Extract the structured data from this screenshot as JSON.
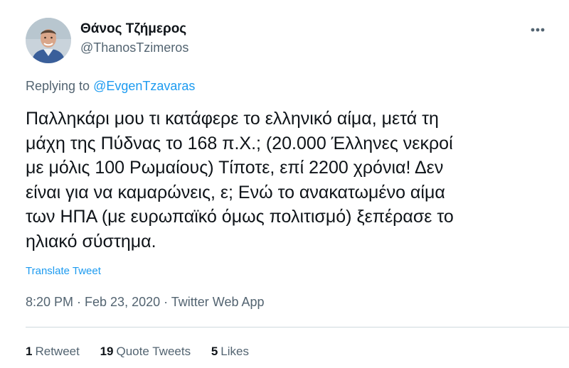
{
  "author": {
    "display_name": "Θάνος Τζήμερος",
    "handle": "@ThanosTzimeros"
  },
  "reply": {
    "prefix": "Replying to",
    "mention": "@EvgenTzavaras"
  },
  "tweet": {
    "lines": [
      "Παλληκάρι μου τι κατάφερε το ελληνικό αίμα, μετά τη",
      "μάχη της Πύδνας το 168 π.Χ.; (20.000 Έλληνες νεκροί",
      "με μόλις 100 Ρωμαίους) Τίποτε, επί 2200 χρόνια! Δεν",
      "είναι για να καμαρώνεις, ε; Ενώ το ανακατωμένο αίμα",
      "των ΗΠΑ (με ευρωπαϊκό όμως πολιτισμό) ξεπέρασε το",
      "ηλιακό σύστημα."
    ],
    "translate_label": "Translate Tweet",
    "timestamp": "8:20 PM · Feb 23, 2020 · Twitter Web App"
  },
  "stats": {
    "retweets_count": "1",
    "retweets_label": "Retweet",
    "quotes_count": "19",
    "quotes_label": "Quote Tweets",
    "likes_count": "5",
    "likes_label": "Likes"
  },
  "icons": {
    "more": "more-horizontal-icon",
    "avatar": "avatar-image"
  },
  "colors": {
    "link": "#1d9bf0",
    "secondary_text": "#536471",
    "primary_text": "#0f1419",
    "divider": "#cfd9de"
  }
}
